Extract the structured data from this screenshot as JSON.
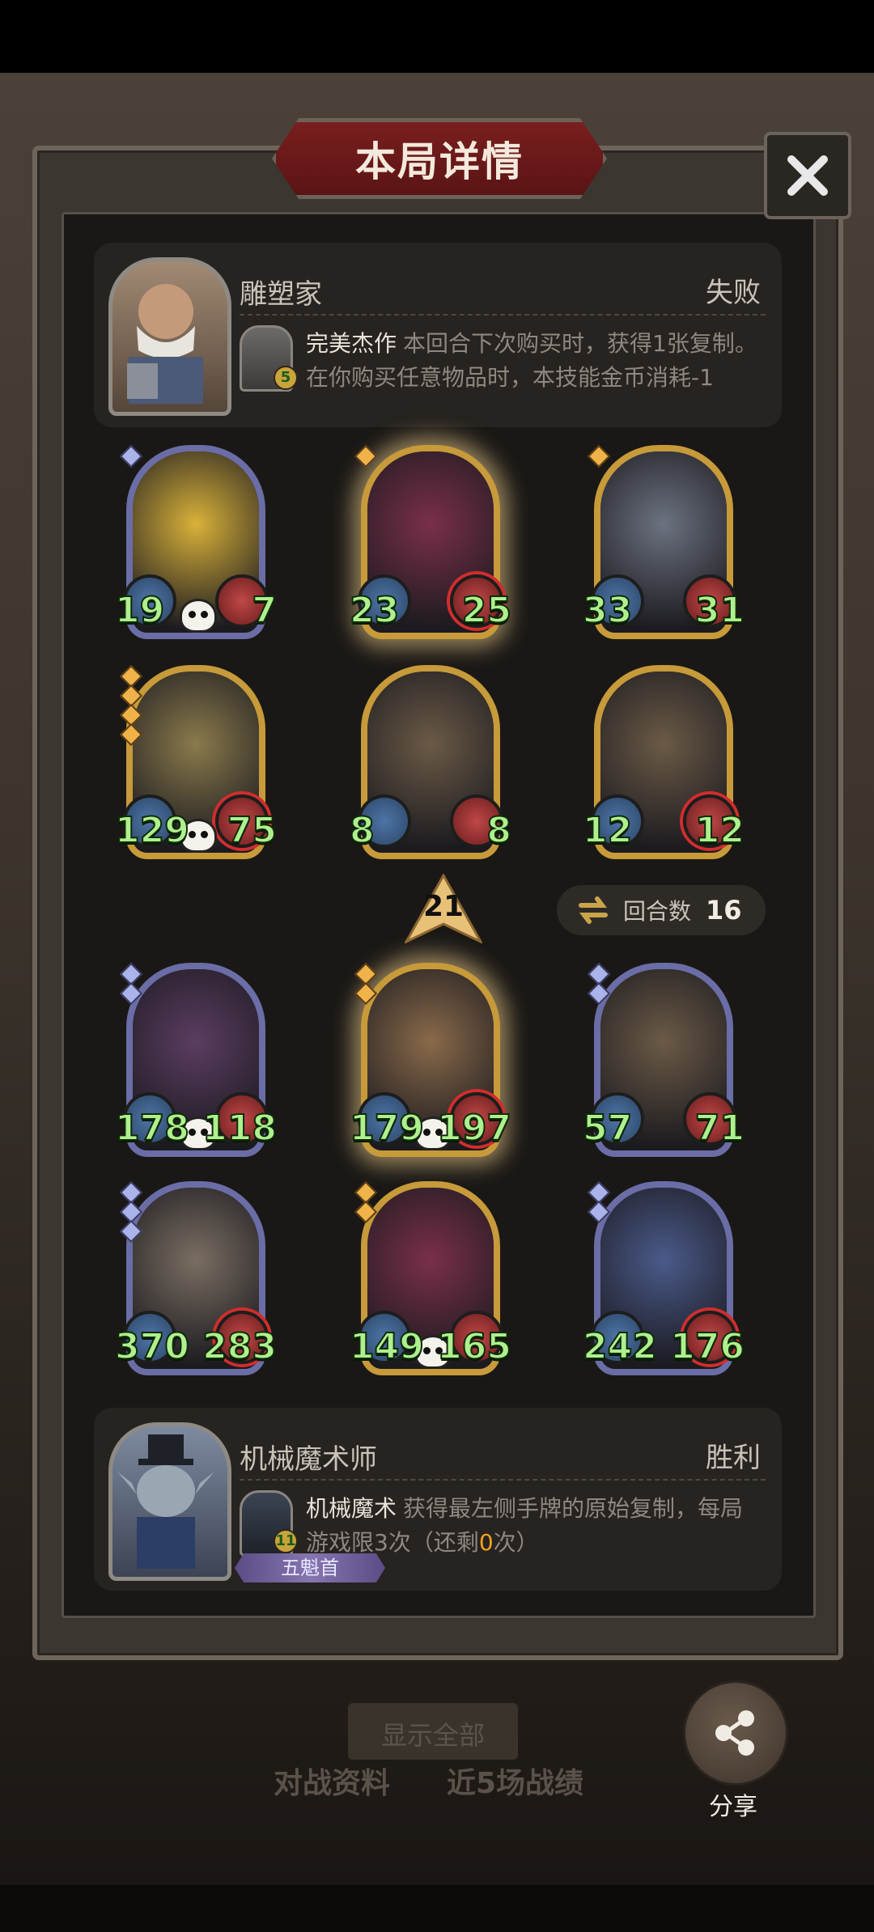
{
  "window": {
    "title": "本局详情"
  },
  "background": {
    "show_all": "显示全部",
    "tabs": [
      "对战资料",
      "近5场战绩"
    ],
    "share_label": "分享"
  },
  "opponent": {
    "name": "雕塑家",
    "result": "失败",
    "skill_name": "完美杰作",
    "skill_desc": "本回合下次购买时，获得1张复制。在你购买任意物品时，本技能金币消耗-1",
    "skill_level": "5"
  },
  "opponent_cards": [
    {
      "name": "bomber-goblin",
      "atk": "19",
      "hp": "7",
      "frame": "purple",
      "tier": 1,
      "skull": true,
      "art": "#d9b23a"
    },
    {
      "name": "clown",
      "atk": "23",
      "hp": "25",
      "frame": "gold",
      "tier": 1,
      "glow": true,
      "art": "#7a2f4a"
    },
    {
      "name": "armored-goblin",
      "atk": "33",
      "hp": "31",
      "frame": "gold",
      "tier": 1,
      "art": "#6c7280"
    },
    {
      "name": "cheese-robot",
      "atk": "129",
      "hp": "75",
      "frame": "gold",
      "tier": 4,
      "skull": true,
      "art": "#8a7a4c"
    },
    {
      "name": "rocket-crate",
      "atk": "8",
      "hp": "8",
      "frame": "gold",
      "tier": 0,
      "art": "#6b5a46"
    },
    {
      "name": "rocket-crate",
      "atk": "12",
      "hp": "12",
      "frame": "gold",
      "tier": 0,
      "art": "#6b5a46"
    }
  ],
  "turn": {
    "level": "21",
    "round_label": "回合数",
    "round_value": "16"
  },
  "player_cards": [
    {
      "name": "witch",
      "atk": "178",
      "hp": "118",
      "frame": "purple",
      "tier": 2,
      "skull": true,
      "art": "#5b3d62"
    },
    {
      "name": "flower-girl",
      "atk": "179",
      "hp": "197",
      "frame": "gold",
      "tier": 2,
      "glow": true,
      "skull": true,
      "art": "#8a6a4a"
    },
    {
      "name": "rocket-crate",
      "atk": "57",
      "hp": "71",
      "frame": "purple",
      "tier": 2,
      "art": "#6b5a46"
    },
    {
      "name": "bearded-warrior",
      "atk": "370",
      "hp": "283",
      "frame": "purple",
      "tier": 3,
      "art": "#7a6e62"
    },
    {
      "name": "clown",
      "atk": "149",
      "hp": "165",
      "frame": "gold",
      "tier": 2,
      "skull": true,
      "art": "#7a2f4a"
    },
    {
      "name": "elf-sorceress",
      "atk": "242",
      "hp": "176",
      "frame": "purple",
      "tier": 2,
      "art": "#4a5a8a"
    }
  ],
  "player": {
    "name": "机械魔术师",
    "result": "胜利",
    "skill_name": "机械魔术",
    "skill_desc_a": "获得最左侧手牌的原始复制，每局游戏限3次（还剩",
    "skill_remaining": "0",
    "skill_desc_b": "次）",
    "skill_level": "11",
    "rank_badge": "五魁首"
  },
  "colors": {
    "accent_gold": "#c79a3a",
    "frame_purple": "#6a6da6",
    "stat_green": "#aef08e",
    "banner_red": "#6a1818"
  }
}
